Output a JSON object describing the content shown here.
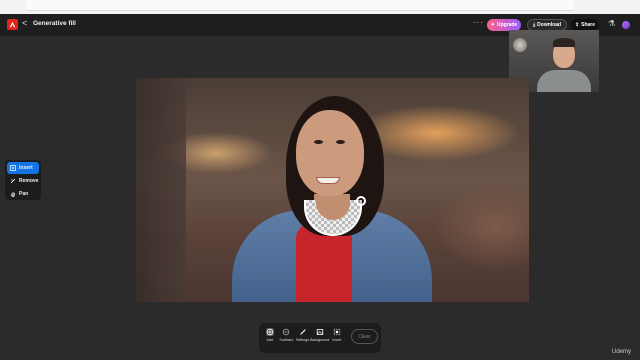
{
  "app": {
    "title": "Generative fill",
    "back_symbol": "<",
    "more_symbol": "···"
  },
  "header": {
    "upgrade_label": "Upgrade",
    "download_label": "Download",
    "share_label": "Share"
  },
  "tools": [
    {
      "label": "Insert",
      "icon": "insert-icon",
      "active": true
    },
    {
      "label": "Remove",
      "icon": "remove-icon",
      "active": false
    },
    {
      "label": "Pan",
      "icon": "pan-icon",
      "active": false
    }
  ],
  "bottom_toolbar": {
    "items": [
      {
        "label": "Add",
        "icon": "add-icon",
        "active": true
      },
      {
        "label": "Subtract",
        "icon": "subtract-icon",
        "active": false
      },
      {
        "label": "Settings",
        "icon": "brush-icon",
        "active": false
      },
      {
        "label": "Background",
        "icon": "background-icon",
        "active": false
      },
      {
        "label": "Invert",
        "icon": "invert-icon",
        "active": false
      }
    ],
    "clear_label": "Clear"
  },
  "watermark": "Udemy",
  "colors": {
    "accent_blue": "#1473e6",
    "adobe_red": "#e3231b",
    "upgrade_gradient_start": "#ff5f87",
    "upgrade_gradient_end": "#9a5cff",
    "background": "#2b2b2b"
  }
}
